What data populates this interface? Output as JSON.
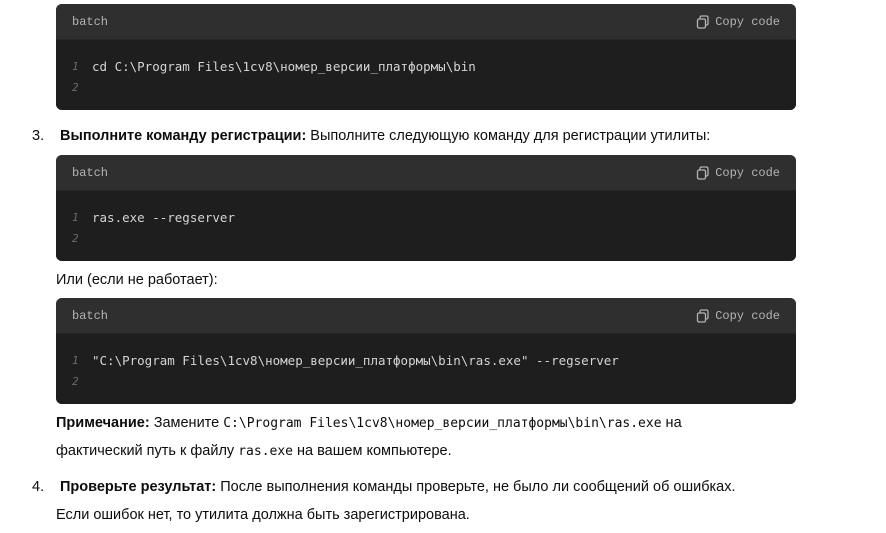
{
  "blocks": [
    {
      "lang": "batch",
      "copy_label": "Copy code",
      "lines": [
        "cd C:\\Program Files\\1cv8\\номер_версии_платформы\\bin",
        ""
      ]
    },
    {
      "lang": "batch",
      "copy_label": "Copy code",
      "lines": [
        "ras.exe --regserver",
        ""
      ]
    },
    {
      "lang": "batch",
      "copy_label": "Copy code",
      "lines": [
        "\"C:\\Program Files\\1cv8\\номер_версии_платформы\\bin\\ras.exe\" --regserver",
        ""
      ]
    }
  ],
  "line_numbers": [
    "1",
    "2"
  ],
  "step3": {
    "num": "3.",
    "bold": "Выполните команду регистрации:",
    "rest": " Выполните следующую команду для регистрации утилиты:"
  },
  "or_text": "Или (если не работает):",
  "note": {
    "bold": "Примечание:",
    "before": " Замените ",
    "code1": "C:\\Program Files\\1cv8\\номер_версии_платформы\\bin\\ras.exe",
    "after": " на",
    "line2_before": "фактический путь к файлу ",
    "code2": "ras.exe",
    "line2_after": " на вашем компьютере."
  },
  "step4": {
    "num": "4.",
    "bold": "Проверьте результат:",
    "rest": " После выполнения команды проверьте, не было ли сообщений об ошибках.",
    "line2": "Если ошибок нет, то утилита должна быть зарегистрирована."
  }
}
